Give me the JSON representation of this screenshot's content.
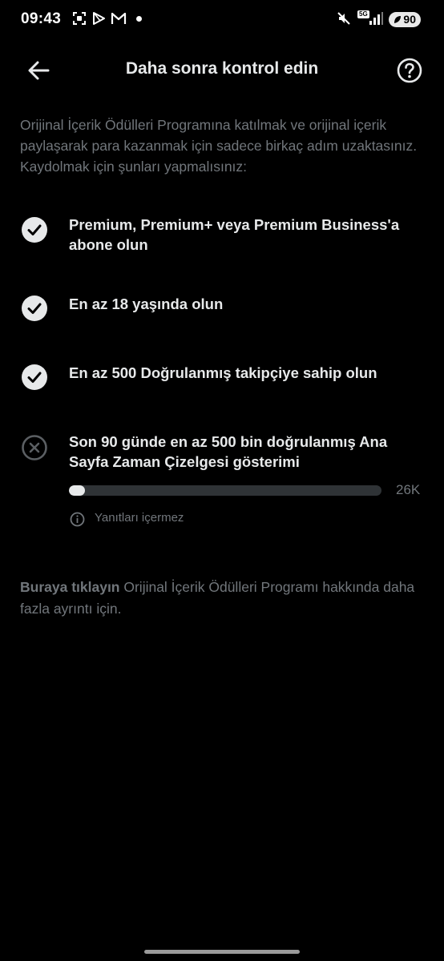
{
  "status_bar": {
    "time": "09:43",
    "network": "5G",
    "battery": "90"
  },
  "header": {
    "title": "Daha sonra kontrol edin",
    "back_icon": "arrow-left-icon",
    "help_icon": "question-circle-icon"
  },
  "intro": "Orijinal İçerik Ödülleri Programına katılmak ve orijinal içerik paylaşarak para kazanmak için sadece birkaç adım uzaktasınız. Kaydolmak için şunları yapmalısınız:",
  "requirements": [
    {
      "text": "Premium, Premium+ veya Premium Business'a abone olun",
      "status": "complete",
      "icon": "check-circle-icon"
    },
    {
      "text": "En az 18 yaşında olun",
      "status": "complete",
      "icon": "check-circle-icon"
    },
    {
      "text": "En az 500 Doğrulanmış takipçiye sahip olun",
      "status": "complete",
      "icon": "check-circle-icon"
    },
    {
      "text": "Son 90 günde en az 500 bin doğrulanmış Ana Sayfa Zaman Çizelgesi gösterimi",
      "status": "incomplete",
      "icon": "x-circle-icon"
    }
  ],
  "progress": {
    "value_label": "26K",
    "fraction": 0.052
  },
  "note": {
    "icon": "info-icon",
    "text": "Yanıtları içermez"
  },
  "footer": {
    "link_text": "Buraya tıklayın",
    "text": " Orijinal İçerik Ödülleri Programı hakkında daha fazla ayrıntı için."
  },
  "colors": {
    "background": "#000000",
    "primary_text": "#e7e9ea",
    "secondary_text": "#71767b",
    "progress_track": "#2f3336"
  }
}
